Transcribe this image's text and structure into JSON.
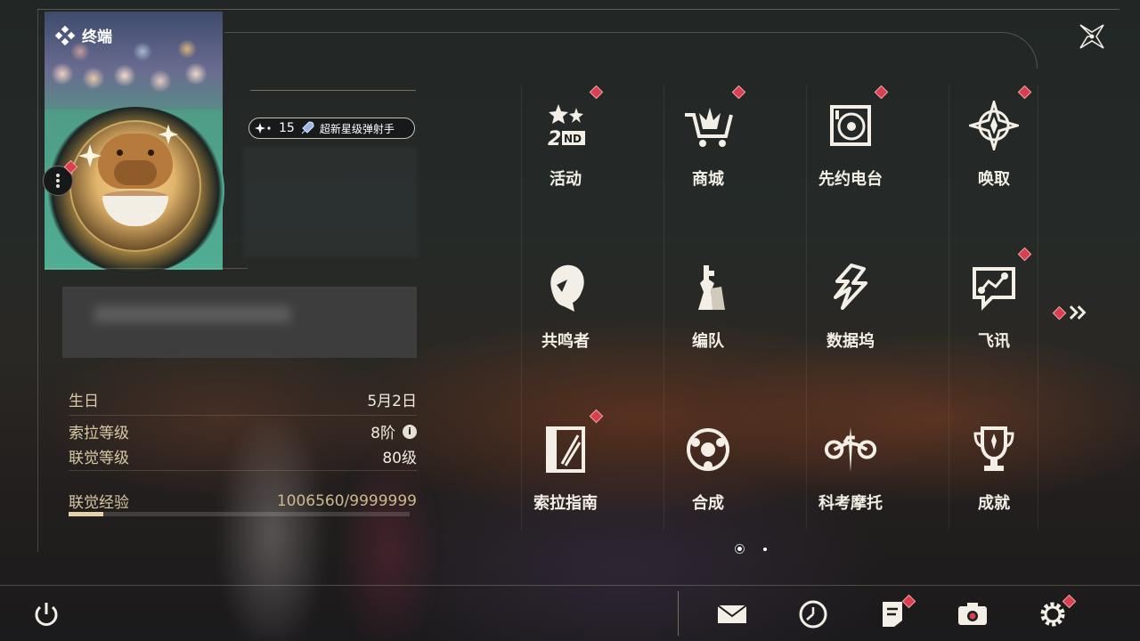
{
  "terminal": {
    "title": "终端"
  },
  "profile": {
    "badge_level": "15",
    "badge_title": "超新星级弹射手",
    "info": [
      {
        "label": "生日",
        "value": "5月2日"
      },
      {
        "label": "索拉等级",
        "value": "8阶"
      },
      {
        "label": "联觉等级",
        "value": "80级"
      }
    ],
    "experience": {
      "label": "联觉经验",
      "value": "1006560/9999999",
      "progress": 0.1007
    }
  },
  "menu": {
    "items": [
      {
        "label": "活动",
        "icon": "event-2nd-icon",
        "notify": true
      },
      {
        "label": "商城",
        "icon": "shop-cart-icon",
        "notify": true
      },
      {
        "label": "先约电台",
        "icon": "radio-icon",
        "notify": true
      },
      {
        "label": "唤取",
        "icon": "summon-compass-icon",
        "notify": true
      },
      {
        "label": "共鸣者",
        "icon": "resonator-icon",
        "notify": false
      },
      {
        "label": "编队",
        "icon": "chess-team-icon",
        "notify": false
      },
      {
        "label": "数据坞",
        "icon": "data-dock-icon",
        "notify": false
      },
      {
        "label": "飞讯",
        "icon": "message-chat-icon",
        "notify": true
      },
      {
        "label": "索拉指南",
        "icon": "guidebook-icon",
        "notify": true
      },
      {
        "label": "合成",
        "icon": "synthesis-icon",
        "notify": false
      },
      {
        "label": "科考摩托",
        "icon": "motorbike-icon",
        "notify": false
      },
      {
        "label": "成就",
        "icon": "trophy-icon",
        "notify": false
      }
    ],
    "pages": 2,
    "current_page": 1
  },
  "bottom_bar": {
    "buttons": [
      "power-icon",
      "mail-icon",
      "clock-icon",
      "notice-icon",
      "camera-icon",
      "settings-gear-icon"
    ]
  },
  "colors": {
    "accent": "#d8404e",
    "gold": "#e7d3a6",
    "text": "#f3efe6"
  }
}
